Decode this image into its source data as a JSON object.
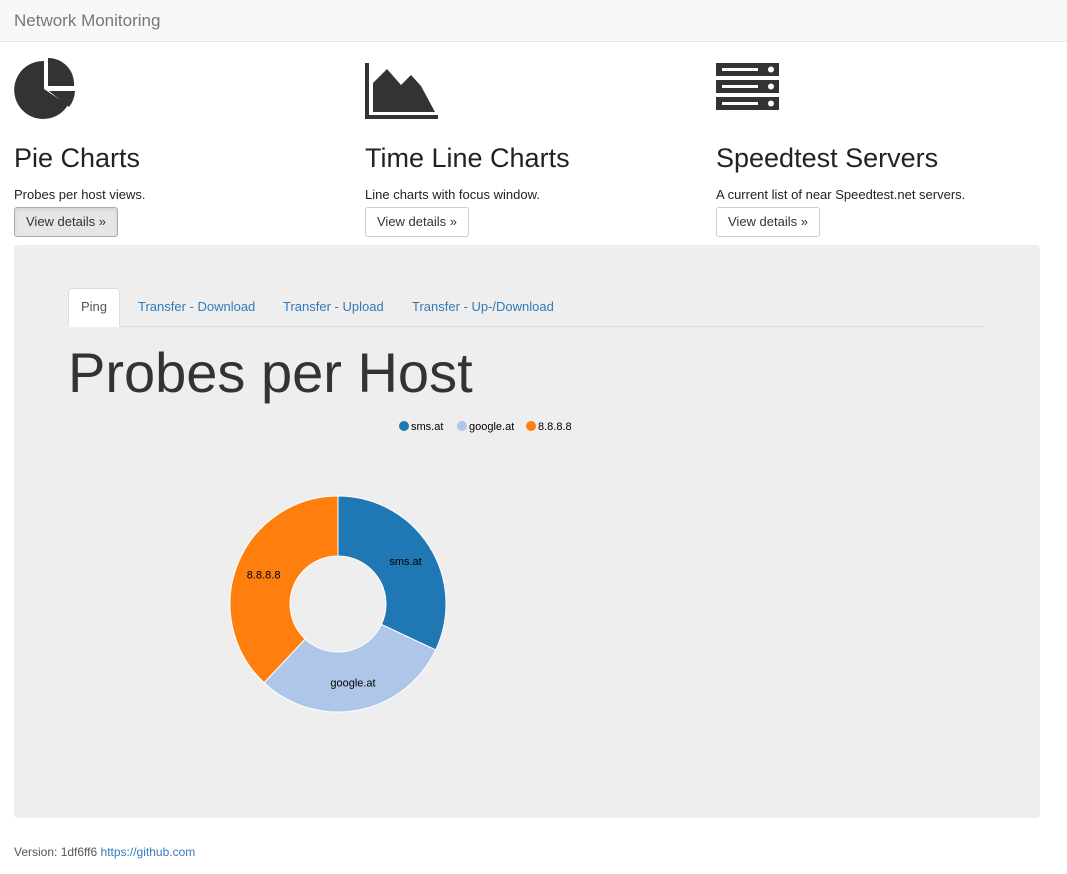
{
  "navbar": {
    "brand": "Network Monitoring"
  },
  "features": [
    {
      "title": "Pie Charts",
      "description": "Probes per host views.",
      "button": "View details »",
      "icon": "pie-chart-icon"
    },
    {
      "title": "Time Line Charts",
      "description": "Line charts with focus window.",
      "button": "View details »",
      "icon": "area-chart-icon"
    },
    {
      "title": "Speedtest Servers",
      "description": "A current list of near Speedtest.net servers.",
      "button": "View details »",
      "icon": "server-icon"
    }
  ],
  "tabs": [
    {
      "label": "Ping",
      "active": true
    },
    {
      "label": "Transfer - Download",
      "active": false
    },
    {
      "label": "Transfer - Upload",
      "active": false
    },
    {
      "label": "Transfer - Up-/Download",
      "active": false
    }
  ],
  "jumbotron": {
    "title": "Probes per Host"
  },
  "chart_data": {
    "type": "pie",
    "donut": true,
    "title": "",
    "legend_position": "top-center",
    "series": [
      {
        "name": "sms.at",
        "value": 32,
        "color": "#1f77b4"
      },
      {
        "name": "google.at",
        "value": 30,
        "color": "#aec7e8"
      },
      {
        "name": "8.8.8.8",
        "value": 38,
        "color": "#ff7f0e"
      }
    ]
  },
  "footer": {
    "version_label": "Version: 1df6ff6",
    "link_text": "https://github.com"
  }
}
